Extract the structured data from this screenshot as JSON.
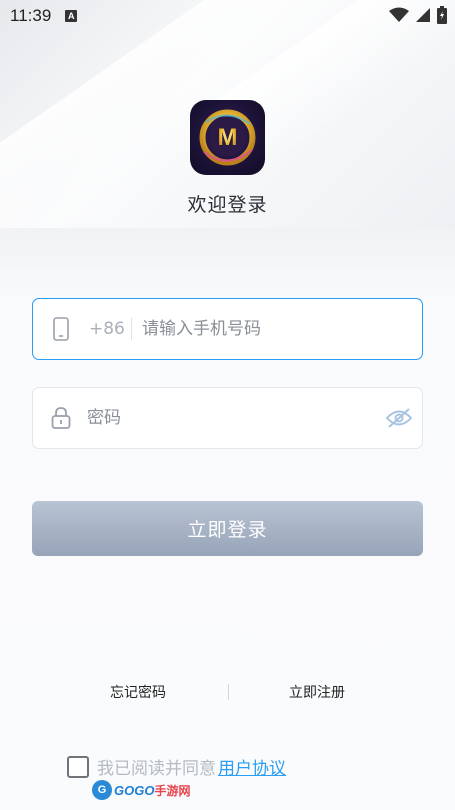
{
  "status_bar": {
    "time": "11:39",
    "notification_glyph": "A"
  },
  "app": {
    "logo_letter": "M",
    "welcome": "欢迎登录"
  },
  "phone_field": {
    "country_code": "+86",
    "placeholder": "请输入手机号码",
    "value": ""
  },
  "password_field": {
    "placeholder": "密码",
    "value": ""
  },
  "login_button": {
    "label": "立即登录"
  },
  "links": {
    "forgot": "忘记密码",
    "register": "立即注册"
  },
  "agreement": {
    "text": "我已阅读并同意",
    "link": "用户协议",
    "checked": false
  },
  "watermark": {
    "logo": "G",
    "brand": "GOGO",
    "cn": "手游网"
  },
  "colors": {
    "accent": "#2a9df4",
    "button": "#a8b4c6"
  }
}
